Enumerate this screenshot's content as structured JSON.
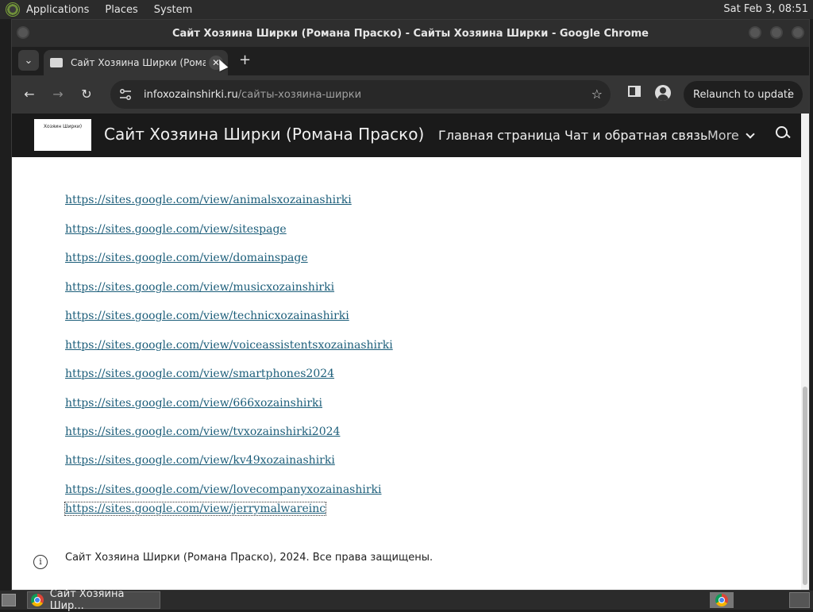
{
  "panel": {
    "menus": [
      "Applications",
      "Places",
      "System"
    ],
    "clock": "Sat Feb  3, 08:51"
  },
  "window": {
    "title": "Сайт Хозяина Ширки (Романа Праско) - Сайты Хозяина Ширки - Google Chrome"
  },
  "tab": {
    "title": "Сайт Хозяина Ширки (Романа",
    "close_glyph": "✕",
    "new_tab_glyph": "+"
  },
  "toolbar": {
    "back_glyph": "←",
    "forward_glyph": "→",
    "reload_glyph": "↻",
    "url_host": "infoxozainshirki.ru",
    "url_path": "/сайты-хозяина-ширки",
    "star_glyph": "☆",
    "relaunch_label": "Relaunch to update",
    "menu_glyph": "⋮"
  },
  "site": {
    "logo_text": "Хозяин Ширки)",
    "title": "Сайт Хозяина Ширки (Романа Праско)",
    "nav": [
      "Главная страница",
      "Чат и обратная связь"
    ],
    "more_label": "More",
    "links": [
      "https://sites.google.com/view/animalsxozainashirki",
      "https://sites.google.com/view/sitespage",
      "https://sites.google.com/view/domainspage",
      "https://sites.google.com/view/musicxozainshirki",
      "https://sites.google.com/view/technicxozainashirki",
      "https://sites.google.com/view/voiceassistentsxozainashirki",
      "https://sites.google.com/view/smartphones2024",
      "https://sites.google.com/view/666xozainshirki",
      "https://sites.google.com/view/tvxozainshirki2024",
      "https://sites.google.com/view/kv49xozainashirki",
      "https://sites.google.com/view/lovecompanyxozainashirki",
      "https://sites.google.com/view/jerrymalwareinc"
    ],
    "footer": "Сайт Хозяина Ширки (Романа Праско), 2024. Все права защищены.",
    "info_glyph": "i"
  },
  "taskbar": {
    "window_item": "Сайт Хозяина Шир..."
  }
}
